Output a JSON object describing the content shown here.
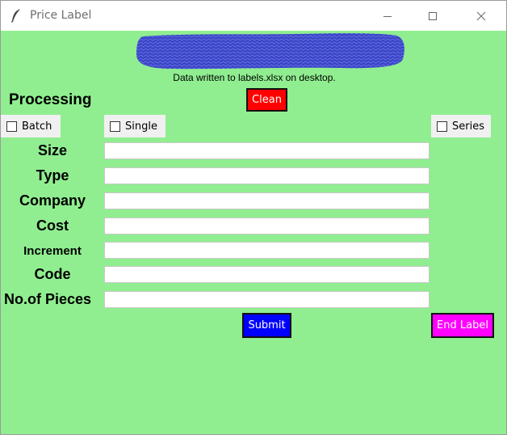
{
  "window": {
    "title": "Price Label"
  },
  "banner": {
    "color": "#3a45c8"
  },
  "status": {
    "message": "Data written to labels.xlsx on desktop."
  },
  "processing": {
    "label": "Processing"
  },
  "clean": {
    "label": "Clean",
    "color": "#ff0000"
  },
  "checkboxes": [
    {
      "label": "Batch",
      "checked": false
    },
    {
      "label": "Single",
      "checked": false
    },
    {
      "label": "Series",
      "checked": false
    }
  ],
  "fields": [
    {
      "label": "Size",
      "value": ""
    },
    {
      "label": "Type",
      "value": ""
    },
    {
      "label": "Company",
      "value": ""
    },
    {
      "label": "Cost",
      "value": ""
    },
    {
      "label": "Increment",
      "value": ""
    },
    {
      "label": "Code",
      "value": ""
    },
    {
      "label": "No.of Pieces",
      "value": ""
    }
  ],
  "submit": {
    "label": "Submit",
    "color": "#0000ff"
  },
  "end_label": {
    "label": "End Label",
    "color": "#ff00ff"
  },
  "colors": {
    "background": "#90ee90"
  }
}
